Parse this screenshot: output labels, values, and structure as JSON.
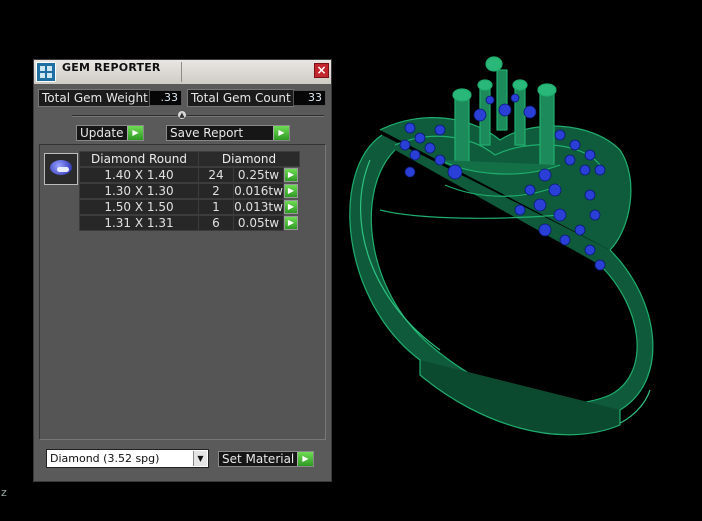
{
  "panel": {
    "title": "GEM REPORTER",
    "close_label": "×",
    "total_weight_label": "Total Gem Weight",
    "total_weight_value": ".33",
    "total_count_label": "Total Gem Count",
    "total_count_value": "33",
    "update_label": "Update",
    "save_report_label": "Save Report",
    "icon_arrow": "▶",
    "divider_arrow": "▲"
  },
  "table": {
    "headers": [
      "Diamond Round",
      "Diamond"
    ],
    "rows": [
      {
        "size": "1.40 X 1.40",
        "count": "24",
        "weight": "0.25tw"
      },
      {
        "size": "1.30 X 1.30",
        "count": "2",
        "weight": "0.016tw"
      },
      {
        "size": "1.50 X 1.50",
        "count": "1",
        "weight": "0.013tw"
      },
      {
        "size": "1.31 X 1.31",
        "count": "6",
        "weight": "0.05tw"
      }
    ]
  },
  "material": {
    "selected": "Diamond    (3.52 spg)",
    "dropdown_arrow": "▼",
    "set_label": "Set Material"
  },
  "viewport": {
    "axis_label": "z",
    "ring_color": "#1f9a66",
    "gem_color": "#2a3fd6"
  },
  "icons": [
    "gem-reporter-app-icon",
    "close-icon",
    "arrow-right-icon",
    "collapse-up-icon",
    "dropdown-arrow-icon",
    "diamond-gem-icon"
  ]
}
